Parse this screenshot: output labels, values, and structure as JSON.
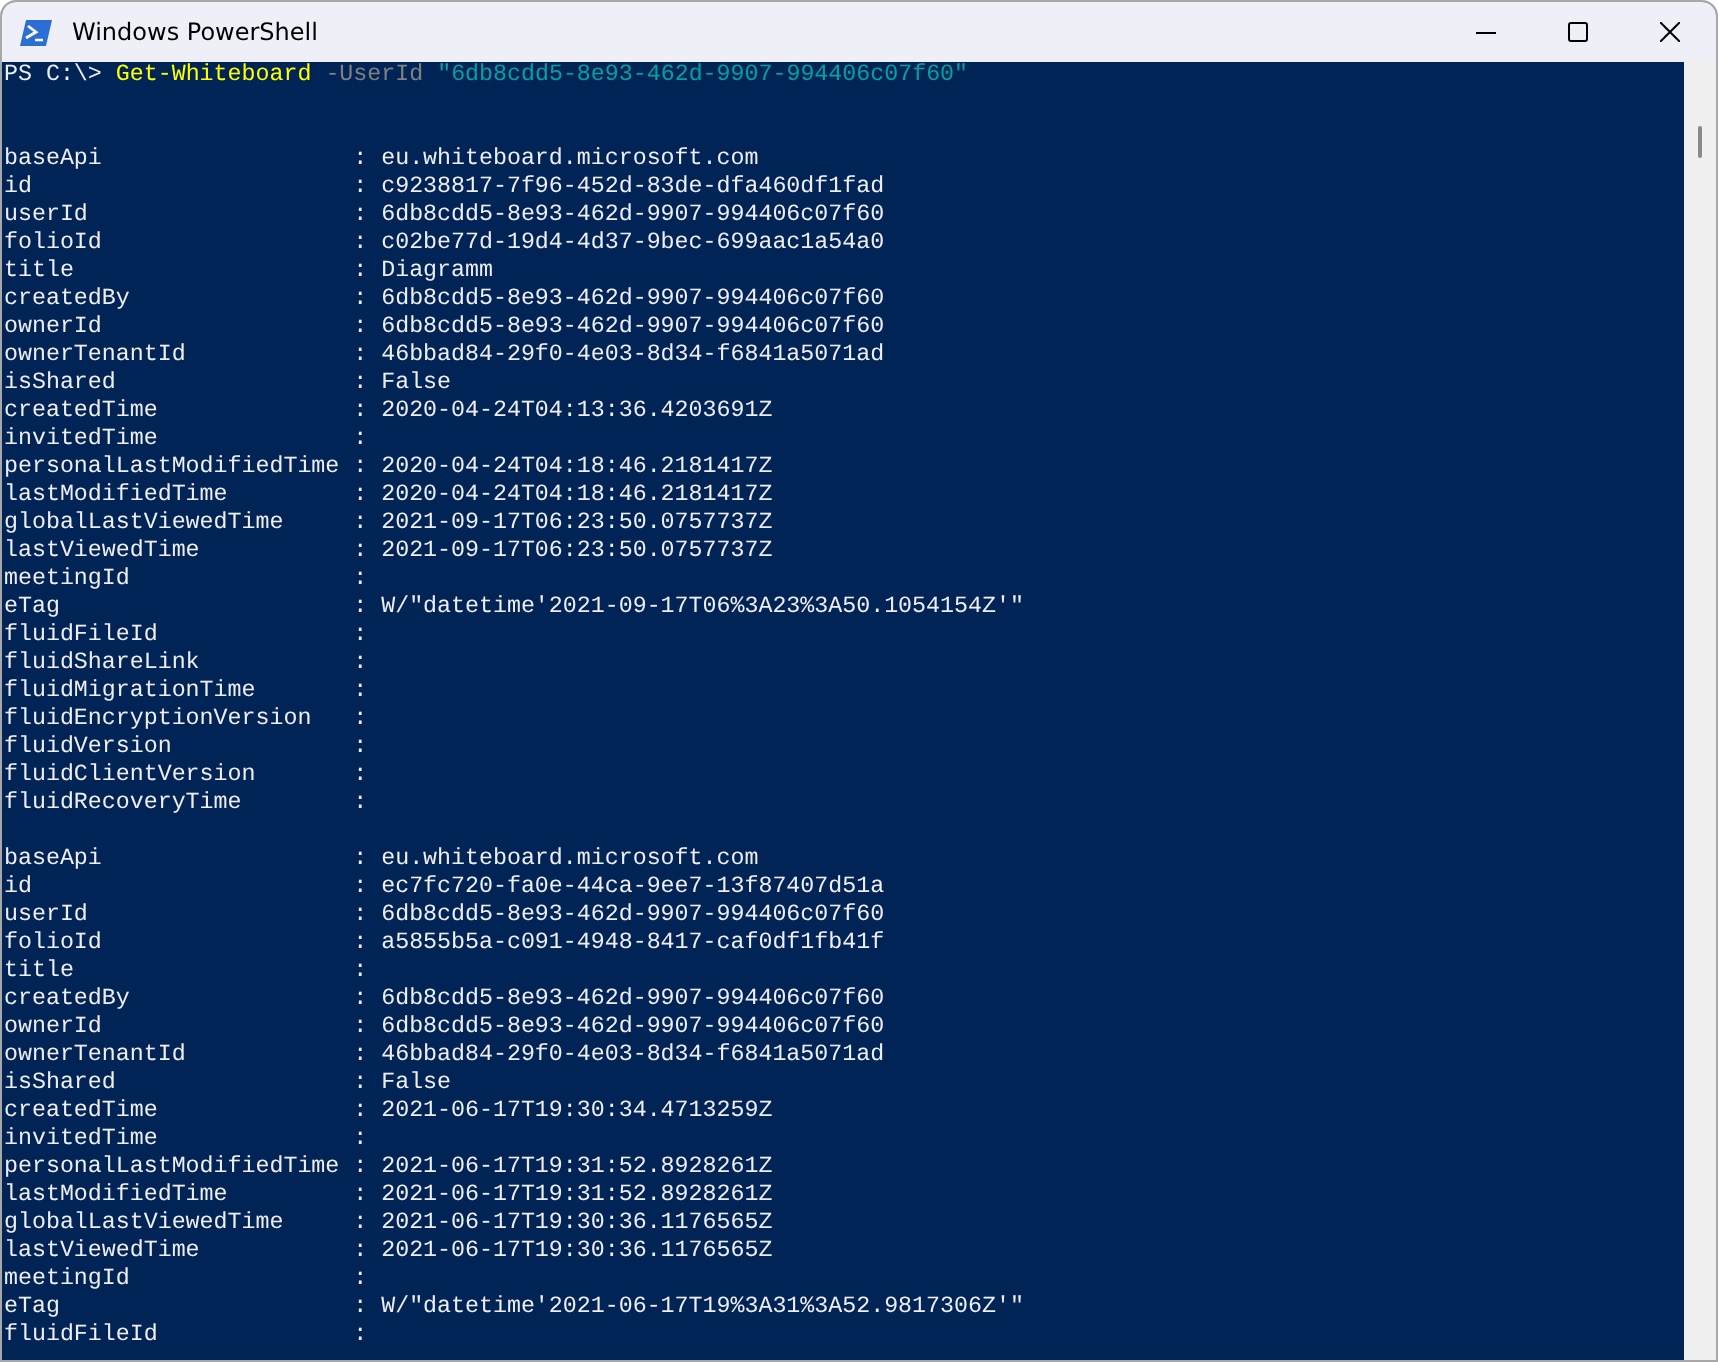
{
  "window": {
    "title": "Windows PowerShell"
  },
  "prompt": [
    {
      "kind": "prompt",
      "text": "PS C:\\> "
    },
    {
      "kind": "command",
      "text": "Get-Whiteboard"
    },
    {
      "kind": "parameter",
      "text": " -UserId "
    },
    {
      "kind": "string",
      "text": "\"6db8cdd5-8e93-462d-9907-994406c07f60\""
    }
  ],
  "records": [
    [
      {
        "name": "baseApi",
        "value": ": eu.whiteboard.microsoft.com"
      },
      {
        "name": "id",
        "value": ": c9238817-7f96-452d-83de-dfa460df1fad"
      },
      {
        "name": "userId",
        "value": ": 6db8cdd5-8e93-462d-9907-994406c07f60"
      },
      {
        "name": "folioId",
        "value": ": c02be77d-19d4-4d37-9bec-699aac1a54a0"
      },
      {
        "name": "title",
        "value": ": Diagramm"
      },
      {
        "name": "createdBy",
        "value": ": 6db8cdd5-8e93-462d-9907-994406c07f60"
      },
      {
        "name": "ownerId",
        "value": ": 6db8cdd5-8e93-462d-9907-994406c07f60"
      },
      {
        "name": "ownerTenantId",
        "value": ": 46bbad84-29f0-4e03-8d34-f6841a5071ad"
      },
      {
        "name": "isShared",
        "value": ": False"
      },
      {
        "name": "createdTime",
        "value": ": 2020-04-24T04:13:36.4203691Z"
      },
      {
        "name": "invitedTime",
        "value": ":"
      },
      {
        "name": "personalLastModifiedTime",
        "value": ": 2020-04-24T04:18:46.2181417Z"
      },
      {
        "name": "lastModifiedTime",
        "value": ": 2020-04-24T04:18:46.2181417Z"
      },
      {
        "name": "globalLastViewedTime",
        "value": ": 2021-09-17T06:23:50.0757737Z"
      },
      {
        "name": "lastViewedTime",
        "value": ": 2021-09-17T06:23:50.0757737Z"
      },
      {
        "name": "meetingId",
        "value": ":"
      },
      {
        "name": "eTag",
        "value": ": W/\"datetime'2021-09-17T06%3A23%3A50.1054154Z'\""
      },
      {
        "name": "fluidFileId",
        "value": ":"
      },
      {
        "name": "fluidShareLink",
        "value": ":"
      },
      {
        "name": "fluidMigrationTime",
        "value": ":"
      },
      {
        "name": "fluidEncryptionVersion",
        "value": ":"
      },
      {
        "name": "fluidVersion",
        "value": ":"
      },
      {
        "name": "fluidClientVersion",
        "value": ":"
      },
      {
        "name": "fluidRecoveryTime",
        "value": ":"
      }
    ],
    [
      {
        "name": "baseApi",
        "value": ": eu.whiteboard.microsoft.com"
      },
      {
        "name": "id",
        "value": ": ec7fc720-fa0e-44ca-9ee7-13f87407d51a"
      },
      {
        "name": "userId",
        "value": ": 6db8cdd5-8e93-462d-9907-994406c07f60"
      },
      {
        "name": "folioId",
        "value": ": a5855b5a-c091-4948-8417-caf0df1fb41f"
      },
      {
        "name": "title",
        "value": ":"
      },
      {
        "name": "createdBy",
        "value": ": 6db8cdd5-8e93-462d-9907-994406c07f60"
      },
      {
        "name": "ownerId",
        "value": ": 6db8cdd5-8e93-462d-9907-994406c07f60"
      },
      {
        "name": "ownerTenantId",
        "value": ": 46bbad84-29f0-4e03-8d34-f6841a5071ad"
      },
      {
        "name": "isShared",
        "value": ": False"
      },
      {
        "name": "createdTime",
        "value": ": 2021-06-17T19:30:34.4713259Z"
      },
      {
        "name": "invitedTime",
        "value": ":"
      },
      {
        "name": "personalLastModifiedTime",
        "value": ": 2021-06-17T19:31:52.8928261Z"
      },
      {
        "name": "lastModifiedTime",
        "value": ": 2021-06-17T19:31:52.8928261Z"
      },
      {
        "name": "globalLastViewedTime",
        "value": ": 2021-06-17T19:30:36.1176565Z"
      },
      {
        "name": "lastViewedTime",
        "value": ": 2021-06-17T19:30:36.1176565Z"
      },
      {
        "name": "meetingId",
        "value": ":"
      },
      {
        "name": "eTag",
        "value": ": W/\"datetime'2021-06-17T19%3A31%3A52.9817306Z'\""
      },
      {
        "name": "fluidFileId",
        "value": ":"
      }
    ]
  ]
}
